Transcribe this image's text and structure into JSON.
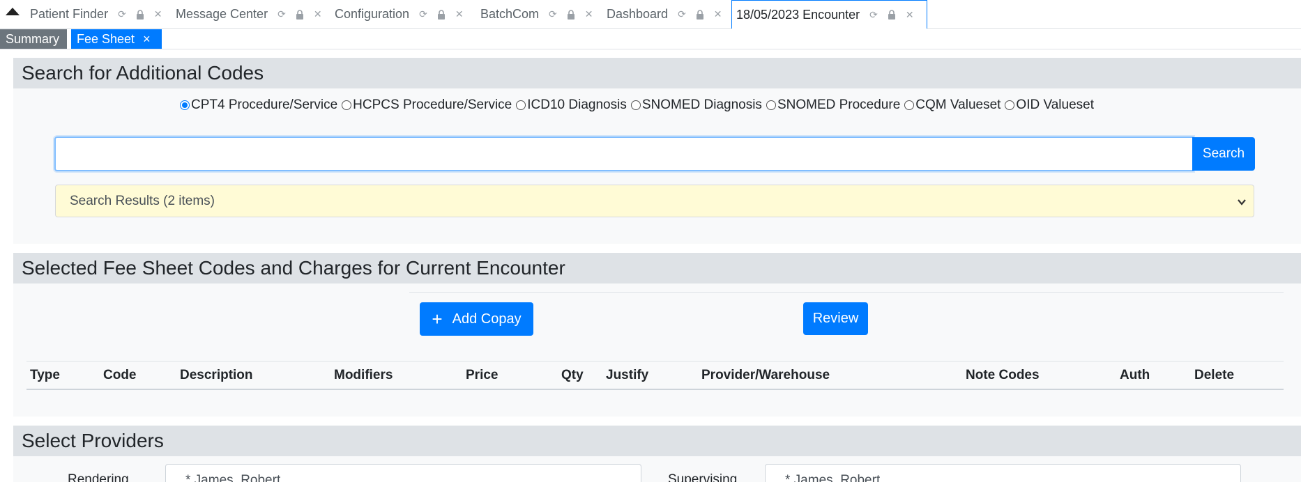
{
  "top_tabs": [
    {
      "label": "Patient Finder"
    },
    {
      "label": "Message Center"
    },
    {
      "label": "Configuration"
    },
    {
      "label": "BatchCom"
    },
    {
      "label": "Dashboard"
    },
    {
      "label": "18/05/2023 Encounter"
    }
  ],
  "sub_tabs": {
    "summary": "Summary",
    "fee_sheet": "Fee Sheet",
    "close_glyph": "×"
  },
  "search_section": {
    "title": "Search for Additional Codes",
    "code_types": [
      {
        "label": "CPT4 Procedure/Service",
        "checked": true
      },
      {
        "label": "HCPCS Procedure/Service",
        "checked": false
      },
      {
        "label": "ICD10 Diagnosis",
        "checked": false
      },
      {
        "label": "SNOMED Diagnosis",
        "checked": false
      },
      {
        "label": "SNOMED Procedure",
        "checked": false
      },
      {
        "label": "CQM Valueset",
        "checked": false
      },
      {
        "label": "OID Valueset",
        "checked": false
      }
    ],
    "search_value": "",
    "search_button": "Search",
    "results_label": "Search Results (2 items)"
  },
  "fee_section": {
    "title": "Selected Fee Sheet Codes and Charges for Current Encounter",
    "add_copay_label": "Add Copay",
    "review_label": "Review",
    "columns": [
      "Type",
      "Code",
      "Description",
      "Modifiers",
      "Price",
      "Qty",
      "Justify",
      "Provider/Warehouse",
      "Note Codes",
      "Auth",
      "Delete"
    ]
  },
  "providers_section": {
    "title": "Select Providers",
    "rendering_label": "Rendering",
    "rendering_value": "* James, Robert",
    "supervising_label": "Supervising",
    "supervising_value": "* James, Robert"
  },
  "colors": {
    "primary": "#007bff",
    "secondary": "#6c757d",
    "section_header": "#dee2e6",
    "results_bg": "#fffbd6"
  }
}
